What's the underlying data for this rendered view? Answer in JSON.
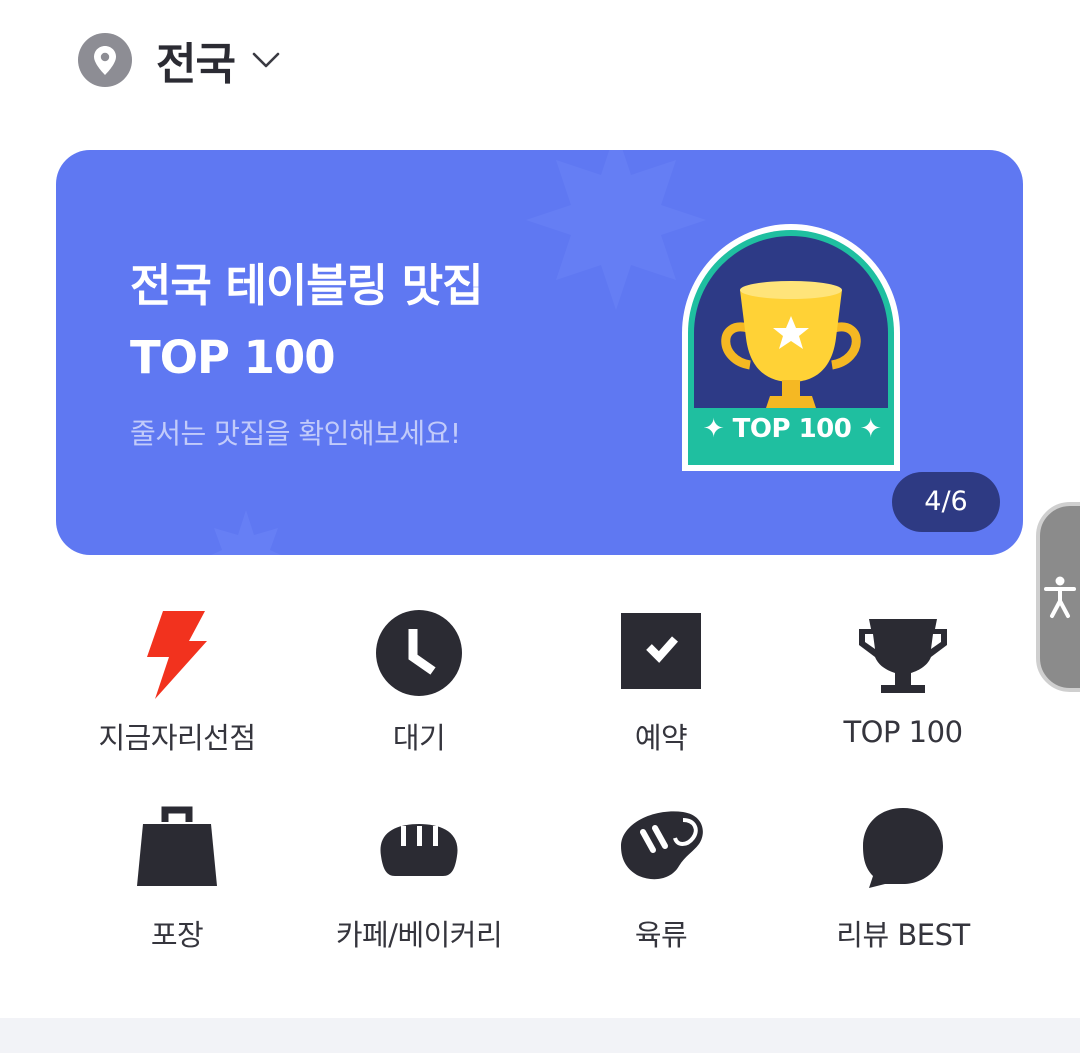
{
  "location": {
    "name": "전국",
    "icon": "location-pin-icon",
    "dropdown_icon": "chevron-down-icon"
  },
  "banner": {
    "title_line1": "전국 테이블링 맛집",
    "title_line2": "TOP 100",
    "subtitle": "줄서는 맛집을 확인해보세요!",
    "badge_label": "✦ TOP 100 ✦",
    "badge_icon": "trophy-icon",
    "counter": "4/6",
    "colors": {
      "background": "#5f78f2",
      "badge_bg": "#2d3a86",
      "badge_ribbon": "#1fbfa0",
      "counter_bg": "#2e3a83"
    }
  },
  "categories": [
    {
      "label": "지금자리선점",
      "icon": "lightning-icon",
      "color": "#f2321e"
    },
    {
      "label": "대기",
      "icon": "clock-icon",
      "color": "#2b2b33"
    },
    {
      "label": "예약",
      "icon": "check-box-icon",
      "color": "#2b2b33"
    },
    {
      "label": "TOP 100",
      "icon": "trophy-icon",
      "color": "#2b2b33"
    },
    {
      "label": "포장",
      "icon": "shopping-bag-icon",
      "color": "#2b2b33"
    },
    {
      "label": "카페/베이커리",
      "icon": "bread-icon",
      "color": "#2b2b33"
    },
    {
      "label": "육류",
      "icon": "meat-icon",
      "color": "#2b2b33"
    },
    {
      "label": "리뷰 BEST",
      "icon": "speech-bubble-icon",
      "color": "#2b2b33"
    }
  ],
  "accessibility": {
    "icon": "accessibility-person-icon"
  }
}
